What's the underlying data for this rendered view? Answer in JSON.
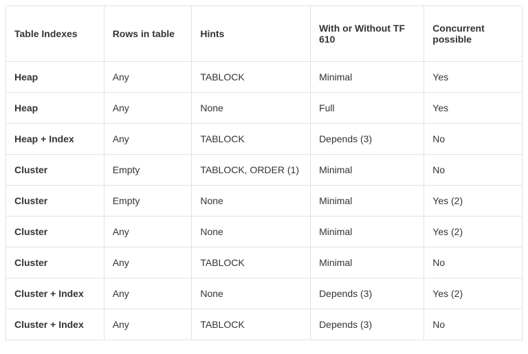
{
  "chart_data": {
    "type": "table",
    "columns": [
      "Table Indexes",
      "Rows in table",
      "Hints",
      "With or Without TF 610",
      "Concurrent possible"
    ],
    "rows": [
      [
        "Heap",
        "Any",
        "TABLOCK",
        "Minimal",
        "Yes"
      ],
      [
        "Heap",
        "Any",
        "None",
        "Full",
        "Yes"
      ],
      [
        "Heap + Index",
        "Any",
        "TABLOCK",
        "Depends (3)",
        "No"
      ],
      [
        "Cluster",
        "Empty",
        "TABLOCK, ORDER (1)",
        "Minimal",
        "No"
      ],
      [
        "Cluster",
        "Empty",
        "None",
        "Minimal",
        "Yes (2)"
      ],
      [
        "Cluster",
        "Any",
        "None",
        "Minimal",
        "Yes (2)"
      ],
      [
        "Cluster",
        "Any",
        "TABLOCK",
        "Minimal",
        "No"
      ],
      [
        "Cluster + Index",
        "Any",
        "None",
        "Depends (3)",
        "Yes (2)"
      ],
      [
        "Cluster + Index",
        "Any",
        "TABLOCK",
        "Depends (3)",
        "No"
      ]
    ]
  }
}
